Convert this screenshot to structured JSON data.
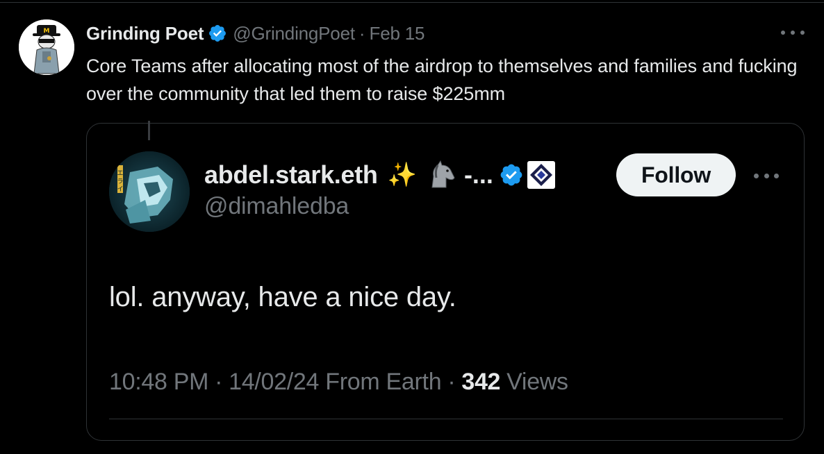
{
  "tweet": {
    "author": {
      "display_name": "Grinding Poet",
      "handle": "@GrindingPoet",
      "verified": true,
      "avatar_icon": "bandit-character-avatar"
    },
    "separator": "·",
    "date": "Feb 15",
    "text": "Core Teams after allocating most of the airdrop to themselves and families and fucking over the community that led them to raise $225mm",
    "more_icon": "more-horizontal-icon"
  },
  "quoted_tweet": {
    "author": {
      "display_name": "abdel.stark.eth",
      "name_emoji_1": "✨",
      "name_emoji_2_icon": "unicorn-icon",
      "name_suffix": "-...",
      "handle": "@dimahledba",
      "verified": true,
      "affiliate_badge_icon": "starknet-affiliate-badge-icon",
      "avatar_icon": "anime-robot-avatar"
    },
    "follow_label": "Follow",
    "text": "lol. anyway, have a nice day.",
    "time": "10:48 PM",
    "separator": "·",
    "date": "14/02/24 From Earth",
    "views_count": "342",
    "views_label": "Views"
  },
  "colors": {
    "background": "#000000",
    "primary_text": "#e7e9ea",
    "secondary_text": "#71767b",
    "verified_blue": "#1d9bf0",
    "border": "#2f3336",
    "follow_bg": "#eff3f4"
  }
}
